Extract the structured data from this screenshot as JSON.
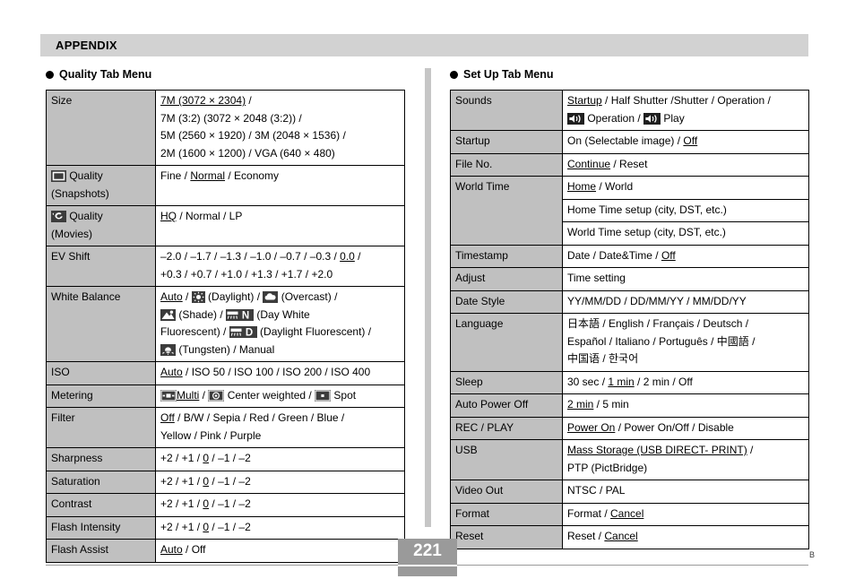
{
  "header": {
    "band_title": "APPENDIX"
  },
  "left_column": {
    "heading": "Quality Tab Menu",
    "table": {
      "rows": [
        {
          "label": "Size",
          "label_icon": null,
          "label_sub": null,
          "lines": [
            "7M (3072 × 2304) /",
            "7M (3:2) (3072 × 2048 (3:2)) /",
            "5M (2560 × 1920) / 3M (2048 × 1536) /",
            "2M (1600 × 1200) / VGA (640 × 480)"
          ],
          "underlined": "7M (3072 × 2304)"
        },
        {
          "label": "Quality",
          "label_icon": "snapshot-quality-icon",
          "label_sub": "(Snapshots)",
          "lines": [
            "Fine / Normal / Economy"
          ],
          "underlined": "Normal"
        },
        {
          "label": "Quality",
          "label_icon": "movie-quality-icon",
          "label_sub": "(Movies)",
          "lines": [
            "HQ / Normal / LP"
          ],
          "underlined": "HQ"
        },
        {
          "label": "EV Shift",
          "label_icon": null,
          "label_sub": null,
          "lines": [
            "–2.0 / –1.7 / –1.3 / –1.0 / –0.7 / –0.3 / 0.0 /",
            "+0.3 / +0.7 / +1.0 / +1.3 / +1.7 / +2.0"
          ],
          "underlined": "0.0"
        },
        {
          "label": "White Balance",
          "label_icon": null,
          "label_sub": null,
          "lines": [
            "Auto / [daylight-icon] (Daylight) / [overcast-icon] (Overcast) /",
            "[shade-icon] (Shade) / [day-white-fluorescent-icon] (Day White",
            "Fluorescent) / [daylight-fluorescent-icon] (Daylight Fluorescent) /",
            "[tungsten-icon] (Tungsten) / Manual"
          ],
          "underlined": "Auto"
        },
        {
          "label": "ISO",
          "label_icon": null,
          "label_sub": null,
          "lines": [
            "Auto / ISO 50 / ISO 100 / ISO 200 / ISO 400"
          ],
          "underlined": "Auto"
        },
        {
          "label": "Metering",
          "label_icon": null,
          "label_sub": null,
          "lines": [
            "[multi-metering-icon] Multi / [center-weighted-icon] Center weighted / [spot-metering-icon] Spot"
          ],
          "underlined": "Multi"
        },
        {
          "label": "Filter",
          "label_icon": null,
          "label_sub": null,
          "lines": [
            "Off / B/W / Sepia / Red / Green / Blue /",
            "Yellow / Pink / Purple"
          ],
          "underlined": "Off"
        },
        {
          "label": "Sharpness",
          "label_icon": null,
          "label_sub": null,
          "lines": [
            "+2 / +1 / 0 / –1 / –2"
          ],
          "underlined": "0"
        },
        {
          "label": "Saturation",
          "label_icon": null,
          "label_sub": null,
          "lines": [
            "+2 / +1 / 0 / –1 / –2"
          ],
          "underlined": "0"
        },
        {
          "label": "Contrast",
          "label_icon": null,
          "label_sub": null,
          "lines": [
            "+2 / +1 / 0 / –1 / –2"
          ],
          "underlined": "0"
        },
        {
          "label": "Flash Intensity",
          "label_icon": null,
          "label_sub": null,
          "lines": [
            "+2 / +1 / 0 / –1 / –2"
          ],
          "underlined": "0"
        },
        {
          "label": "Flash Assist",
          "label_icon": null,
          "label_sub": null,
          "lines": [
            "Auto / Off"
          ],
          "underlined": "Auto"
        }
      ]
    },
    "cells": {
      "size_l1_a": "7M (3072 × 2304)",
      "size_l1_b": " /",
      "size_l2": "7M (3:2) (3072 × 2048 (3:2)) /",
      "size_l3": "5M (2560 × 1920) / 3M (2048 × 1536) /",
      "size_l4": "2M (1600 × 1200) / VGA (640 × 480)",
      "label_size": "Size",
      "label_quality": "Quality",
      "label_snapshots": "(Snapshots)",
      "label_movies": "(Movies)",
      "snap_a": "Fine / ",
      "snap_b": "Normal",
      "snap_c": " / Economy",
      "mov_a": "HQ",
      "mov_b": " / Normal / LP",
      "label_ev": "EV Shift",
      "ev_l1_a": "–2.0 / –1.7 / –1.3 / –1.0 / –0.7 / –0.3 / ",
      "ev_l1_b": "0.0",
      "ev_l1_c": " /",
      "ev_l2": "+0.3 / +0.7 / +1.0 / +1.3 / +1.7 / +2.0",
      "label_wb": "White Balance",
      "wb_auto": "Auto",
      "wb_1": " / ",
      "wb_daylight": " (Daylight) / ",
      "wb_overcast": " (Overcast) /",
      "wb_shade": " (Shade) / ",
      "wb_daywhite": " (Day White",
      "wb_fluor": "Fluorescent) / ",
      "wb_dayfluor": " (Daylight Fluorescent) /",
      "wb_tungsten": " (Tungsten) / Manual",
      "label_iso": "ISO",
      "iso_a": "Auto",
      "iso_b": " / ISO 50 / ISO 100 / ISO 200 / ISO 400",
      "label_metering": "Metering",
      "met_multi": "Multi",
      "met_sep1": " / ",
      "met_center": " Center weighted / ",
      "met_spot": " Spot",
      "label_filter": "Filter",
      "filter_a": "Off",
      "filter_b": " / B/W / Sepia / Red / Green / Blue /",
      "filter_l2": "Yellow / Pink / Purple",
      "label_sharpness": "Sharpness",
      "label_saturation": "Saturation",
      "label_contrast": "Contrast",
      "label_flash_intensity": "Flash Intensity",
      "label_flash_assist": "Flash Assist",
      "pm_a": "+2 / +1 / ",
      "pm_b": "0",
      "pm_c": " / –1 / –2",
      "fa_a": "Auto",
      "fa_b": " / Off"
    }
  },
  "right_column": {
    "heading": "Set Up Tab Menu",
    "table": {
      "rows": [
        {
          "label": "Sounds",
          "lines": [
            "Startup / Half Shutter /Shutter / Operation /",
            "[speaker-icon] Operation / [speaker-icon] Play"
          ],
          "underlined": "Startup"
        },
        {
          "label": "Startup",
          "lines": [
            "On (Selectable image) / Off"
          ],
          "underlined": "Off"
        },
        {
          "label": "File No.",
          "lines": [
            "Continue / Reset"
          ],
          "underlined": "Continue"
        },
        {
          "label": "World Time",
          "sublines": [
            "Home / World",
            "Home Time setup (city, DST, etc.)",
            "World Time setup (city, DST, etc.)"
          ],
          "underlined": "Home"
        },
        {
          "label": "Timestamp",
          "lines": [
            "Date / Date&Time / Off"
          ],
          "underlined": "Off"
        },
        {
          "label": "Adjust",
          "lines": [
            "Time setting"
          ],
          "underlined": null
        },
        {
          "label": "Date Style",
          "lines": [
            "YY/MM/DD / DD/MM/YY / MM/DD/YY"
          ],
          "underlined": null
        },
        {
          "label": "Language",
          "lines": [
            "日本語 / English / Français / Deutsch /",
            "Español / Italiano / Português / 中國語 /",
            "中国语 / 한국어"
          ],
          "underlined": null
        },
        {
          "label": "Sleep",
          "lines": [
            "30 sec / 1 min / 2 min / Off"
          ],
          "underlined": "1 min"
        },
        {
          "label": "Auto Power Off",
          "lines": [
            "2 min / 5 min"
          ],
          "underlined": "2 min"
        },
        {
          "label": "REC / PLAY",
          "lines": [
            "Power On / Power On/Off / Disable"
          ],
          "underlined": "Power On"
        },
        {
          "label": "USB",
          "lines": [
            "Mass Storage (USB DIRECT- PRINT) /",
            "PTP (PictBridge)"
          ],
          "underlined": "Mass Storage (USB DIRECT- PRINT)"
        },
        {
          "label": "Video Out",
          "lines": [
            "NTSC / PAL"
          ],
          "underlined": null
        },
        {
          "label": "Format",
          "lines": [
            "Format / Cancel"
          ],
          "underlined": "Cancel"
        },
        {
          "label": "Reset",
          "lines": [
            "Reset / Cancel"
          ],
          "underlined": "Cancel"
        }
      ]
    },
    "cells": {
      "label_sounds": "Sounds",
      "sounds_l1_a": "Startup",
      "sounds_l1_b": " / Half Shutter /Shutter / Operation /",
      "sounds_l2_a": " Operation / ",
      "sounds_l2_b": " Play",
      "label_startup": "Startup",
      "startup_a": "On (Selectable image) / ",
      "startup_b": "Off",
      "label_fileno": "File No.",
      "fileno_a": "Continue",
      "fileno_b": " / Reset",
      "label_worldtime": "World Time",
      "wt_1a": "Home",
      "wt_1b": " / World",
      "wt_2": "Home Time setup (city, DST, etc.)",
      "wt_3": "World Time setup (city, DST, etc.)",
      "label_timestamp": "Timestamp",
      "ts_a": "Date / Date&Time / ",
      "ts_b": "Off",
      "label_adjust": "Adjust",
      "adjust_v": "Time setting",
      "label_datestyle": "Date Style",
      "datestyle_v": "YY/MM/DD / DD/MM/YY / MM/DD/YY",
      "label_language": "Language",
      "lang_l1": "日本語 / English / Français / Deutsch /",
      "lang_l2": "Español / Italiano / Português / 中國語 /",
      "lang_l3": "中国语 / 한국어",
      "label_sleep": "Sleep",
      "sleep_a": "30 sec / ",
      "sleep_b": "1 min",
      "sleep_c": " / 2 min / Off",
      "label_autopoweroff": "Auto Power Off",
      "apo_a": "2 min",
      "apo_b": " / 5 min",
      "label_recplay": "REC / PLAY",
      "rp_a": "Power On",
      "rp_b": " / Power On/Off / Disable",
      "label_usb": "USB",
      "usb_l1_a": "Mass Storage (USB DIRECT- PRINT)",
      "usb_l1_b": " /",
      "usb_l2": "PTP (PictBridge)",
      "label_videoout": "Video Out",
      "videoout_v": "NTSC / PAL",
      "label_format": "Format",
      "format_a": "Format / ",
      "format_b": "Cancel",
      "label_reset": "Reset",
      "reset_a": "Reset / ",
      "reset_b": "Cancel"
    }
  },
  "footer": {
    "page_number": "221",
    "corner_mark": "B"
  },
  "colors": {
    "band_gray": "#d2d2d2",
    "label_gray": "#c0c0c0",
    "divider_gray": "#c6c6c6",
    "footer_gray": "#9a9a9a",
    "icon_dark": "#3c3c3c"
  }
}
